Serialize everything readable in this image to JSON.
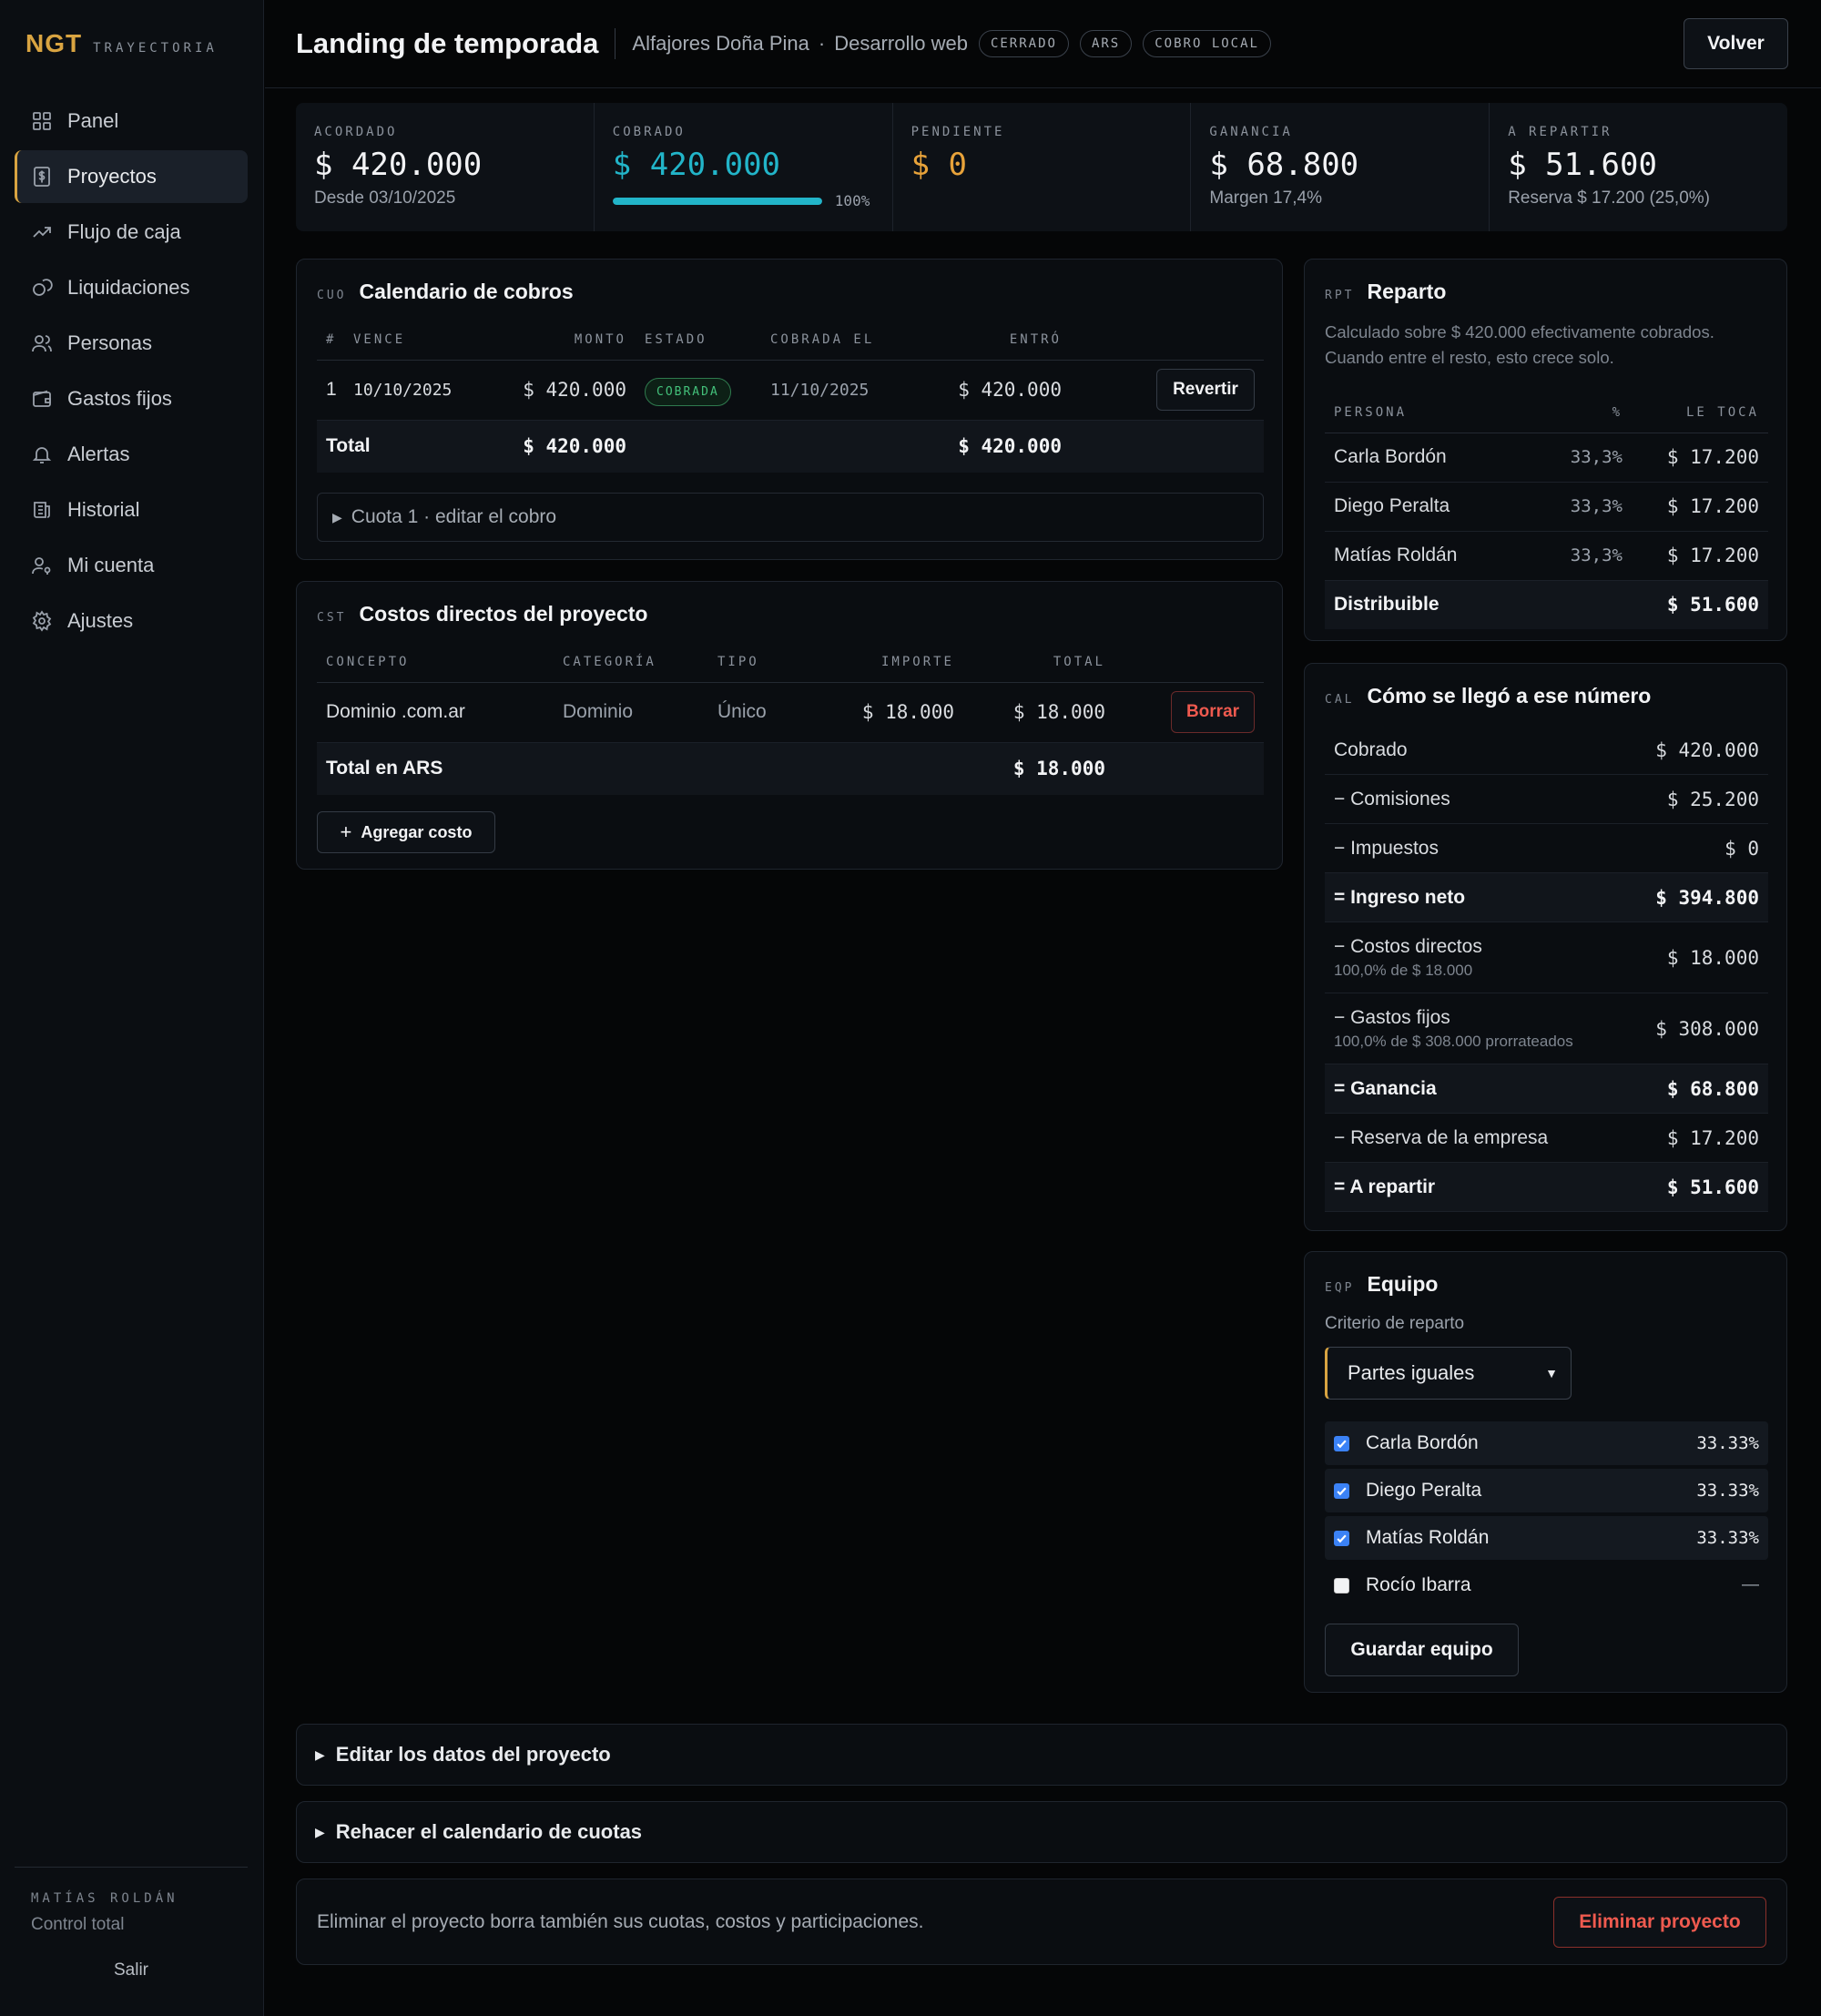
{
  "brand": {
    "logo": "NGT",
    "subtitle": "TRAYECTORIA"
  },
  "nav": [
    {
      "label": "Panel",
      "icon": "grid-icon"
    },
    {
      "label": "Proyectos",
      "icon": "dollar-doc-icon",
      "active": true
    },
    {
      "label": "Flujo de caja",
      "icon": "trend-icon"
    },
    {
      "label": "Liquidaciones",
      "icon": "coins-icon"
    },
    {
      "label": "Personas",
      "icon": "users-icon"
    },
    {
      "label": "Gastos fijos",
      "icon": "wallet-icon"
    },
    {
      "label": "Alertas",
      "icon": "bell-icon"
    },
    {
      "label": "Historial",
      "icon": "history-icon"
    },
    {
      "label": "Mi cuenta",
      "icon": "user-key-icon"
    },
    {
      "label": "Ajustes",
      "icon": "gear-icon"
    }
  ],
  "sidebar_footer": {
    "user": "MATÍAS ROLDÁN",
    "role": "Control total",
    "logout": "Salir"
  },
  "header": {
    "title": "Landing de temporada",
    "client": "Alfajores Doña Pina",
    "separator": "·",
    "type": "Desarrollo web",
    "badges": [
      "CERRADO",
      "ARS",
      "COBRO LOCAL"
    ],
    "back": "Volver"
  },
  "stats": {
    "acordado": {
      "label": "ACORDADO",
      "value": "$ 420.000",
      "sub": "Desde 03/10/2025"
    },
    "cobrado": {
      "label": "COBRADO",
      "value": "$ 420.000",
      "progress": 1.0,
      "pct": "100%"
    },
    "pendiente": {
      "label": "PENDIENTE",
      "value": "$ 0"
    },
    "ganancia": {
      "label": "GANANCIA",
      "value": "$ 68.800",
      "sub": "Margen 17,4%"
    },
    "repartir": {
      "label": "A REPARTIR",
      "value": "$ 51.600",
      "sub": "Reserva $ 17.200 (25,0%)"
    }
  },
  "cobros": {
    "code": "CUO",
    "title": "Calendario de cobros",
    "headers": [
      "#",
      "VENCE",
      "MONTO",
      "ESTADO",
      "COBRADA EL",
      "ENTRÓ"
    ],
    "rows": [
      {
        "n": "1",
        "vence": "10/10/2025",
        "monto": "$ 420.000",
        "estado": "COBRADA",
        "cobrada": "11/10/2025",
        "entro": "$ 420.000",
        "action": "Revertir"
      }
    ],
    "total": {
      "label": "Total",
      "monto": "$ 420.000",
      "entro": "$ 420.000"
    },
    "edit": "Cuota 1 · editar el cobro"
  },
  "costos": {
    "code": "CST",
    "title": "Costos directos del proyecto",
    "headers": [
      "CONCEPTO",
      "CATEGORÍA",
      "TIPO",
      "IMPORTE",
      "TOTAL"
    ],
    "rows": [
      {
        "concepto": "Dominio .com.ar",
        "categoria": "Dominio",
        "tipo": "Único",
        "importe": "$ 18.000",
        "total": "$ 18.000",
        "action": "Borrar"
      }
    ],
    "total": {
      "label": "Total en ARS",
      "total": "$ 18.000"
    },
    "add": "Agregar costo"
  },
  "reparto": {
    "code": "RPT",
    "title": "Reparto",
    "note": "Calculado sobre $ 420.000 efectivamente cobrados. Cuando entre el resto, esto crece solo.",
    "headers": [
      "PERSONA",
      "%",
      "LE TOCA"
    ],
    "rows": [
      {
        "persona": "Carla Bordón",
        "pct": "33,3%",
        "monto": "$ 17.200"
      },
      {
        "persona": "Diego Peralta",
        "pct": "33,3%",
        "monto": "$ 17.200"
      },
      {
        "persona": "Matías Roldán",
        "pct": "33,3%",
        "monto": "$ 17.200"
      }
    ],
    "total": {
      "label": "Distribuible",
      "monto": "$ 51.600"
    }
  },
  "calculo": {
    "code": "CAL",
    "title": "Cómo se llegó a ese número",
    "rows": [
      {
        "label": "Cobrado",
        "value": "$ 420.000"
      },
      {
        "label": "− Comisiones",
        "value": "$ 25.200"
      },
      {
        "label": "− Impuestos",
        "value": "$ 0"
      },
      {
        "label": "= Ingreso neto",
        "value": "$ 394.800",
        "bold": true
      },
      {
        "label": "− Costos directos",
        "sub": "100,0% de $ 18.000",
        "value": "$ 18.000"
      },
      {
        "label": "− Gastos fijos",
        "sub": "100,0% de $ 308.000 prorrateados",
        "value": "$ 308.000"
      },
      {
        "label": "= Ganancia",
        "value": "$ 68.800",
        "bold": true
      },
      {
        "label": "− Reserva de la empresa",
        "value": "$ 17.200"
      },
      {
        "label": "= A repartir",
        "value": "$ 51.600",
        "bold": true
      }
    ]
  },
  "equipo": {
    "code": "EQP",
    "title": "Equipo",
    "criterio_label": "Criterio de reparto",
    "criterio_value": "Partes iguales",
    "members": [
      {
        "name": "Carla Bordón",
        "pct": "33.33%",
        "checked": true
      },
      {
        "name": "Diego Peralta",
        "pct": "33.33%",
        "checked": true
      },
      {
        "name": "Matías Roldán",
        "pct": "33.33%",
        "checked": true
      },
      {
        "name": "Rocío Ibarra",
        "pct": "—",
        "checked": false
      }
    ],
    "save": "Guardar equipo"
  },
  "accordions": {
    "edit_project": "Editar los datos del proyecto",
    "redo_schedule": "Rehacer el calendario de cuotas"
  },
  "danger": {
    "text": "Eliminar el proyecto borra también sus cuotas, costos y participaciones.",
    "button": "Eliminar proyecto"
  },
  "colors": {
    "accent": "#d9a441",
    "cyan": "#22b5c9",
    "pendiente": "#e8a33a",
    "danger": "#ef5a4f",
    "success": "#43c07a"
  }
}
